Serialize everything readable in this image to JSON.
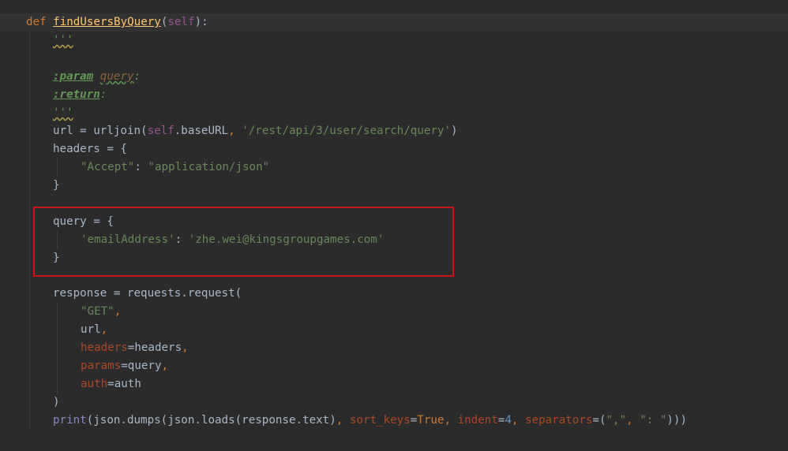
{
  "code": {
    "l1": {
      "kw": "def",
      "fn": "findUsersByQuery",
      "open": "(",
      "self": "self",
      "close": "):"
    },
    "l2": {
      "doc": "'''"
    },
    "l4": {
      "tag": ":param",
      "param": "query",
      "colon": ":"
    },
    "l5": {
      "tag": ":return",
      "colon": ":"
    },
    "l6": {
      "doc": "'''"
    },
    "l7": {
      "a": "url = urljoin(",
      "self": "self",
      ".b": ".baseURL",
      ",": ", ",
      "str": "'/rest/api/3/user/search/query'",
      "end": ")"
    },
    "l8": {
      "a": "headers = {"
    },
    "l9": {
      "k": "\"Accept\"",
      "sep": ": ",
      "v": "\"application/json\""
    },
    "l10": {
      "a": "}"
    },
    "l12": {
      "a": "query = {"
    },
    "l13": {
      "k": "'emailAddress'",
      "sep": ": ",
      "v": "'zhe.wei@kingsgroupgames.com'"
    },
    "l14": {
      "a": "}"
    },
    "l16": {
      "a": "response = requests.request("
    },
    "l17": {
      "s": "\"GET\"",
      "c": ","
    },
    "l18": {
      "a": "url",
      "c": ","
    },
    "l19": {
      "k": "headers",
      "eq": "=headers",
      "c": ","
    },
    "l20": {
      "k": "params",
      "eq": "=query",
      "c": ","
    },
    "l21": {
      "k": "auth",
      "eq": "=auth"
    },
    "l22": {
      "a": ")"
    },
    "l23": {
      "print": "print",
      "a": "(json.dumps(json.loads(response.text)",
      "c1": ", ",
      "k1": "sort_keys",
      "eq1": "=",
      "v1": "True",
      "c2": ", ",
      "k2": "indent",
      "eq2": "=",
      "v2": "4",
      "c3": ", ",
      "k3": "separators",
      "eq3": "=(",
      "s1": "\",\"",
      "c4": ", ",
      "s2": "\": \"",
      "end": ")))"
    }
  },
  "colors": {
    "background": "#2b2b2b",
    "highlight_box": "#c8151a",
    "keyword": "#cc7832",
    "string": "#6a8759"
  }
}
